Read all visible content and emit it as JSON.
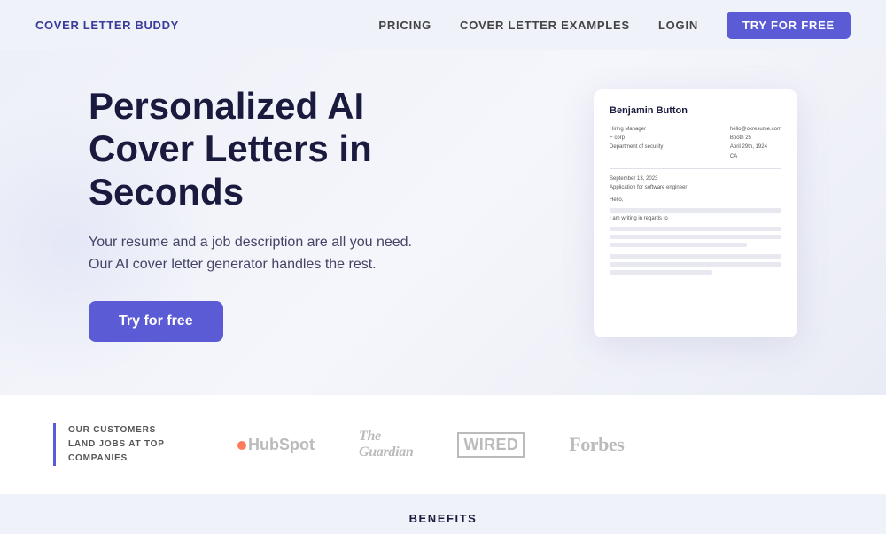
{
  "nav": {
    "logo": "COVER LETTER BUDDY",
    "links": [
      {
        "label": "PRICING",
        "id": "pricing"
      },
      {
        "label": "COVER LETTER EXAMPLES",
        "id": "examples"
      },
      {
        "label": "LOGIN",
        "id": "login"
      }
    ],
    "cta": "TRY FOR FREE"
  },
  "hero": {
    "title": "Personalized AI Cover Letters in Seconds",
    "subtitle": "Your resume and a job description are all you need. Our AI cover letter generator handles the rest.",
    "cta_label": "Try for free"
  },
  "document": {
    "name": "Benjamin Button",
    "addr_left_line1": "Hiring Manager",
    "addr_left_line2": "F corp",
    "addr_left_line3": "Department of security",
    "addr_right_line1": "hello@okresume.com",
    "addr_right_line2": "Booth 25",
    "addr_right_line3": "April 29th, 1924",
    "addr_right_line4": "CA",
    "date": "September 13, 2023",
    "subject": "Application for software engineer",
    "salutation": "Hello,",
    "body_line1": "I am writing in regards to"
  },
  "brands": {
    "tagline_line1": "OUR CUSTOMERS",
    "tagline_line2": "LAND JOBS AT TOP",
    "tagline_line3": "COMPANIES",
    "logos": [
      {
        "name": "HubSpot",
        "id": "hubspot"
      },
      {
        "name": "The Guardian",
        "id": "guardian"
      },
      {
        "name": "WIRED",
        "id": "wired"
      },
      {
        "name": "Forbes",
        "id": "forbes"
      }
    ]
  },
  "benefits": {
    "title": "BENEFITS"
  }
}
